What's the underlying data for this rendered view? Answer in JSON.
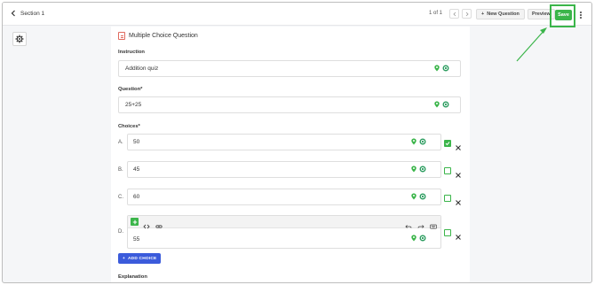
{
  "header": {
    "back_label": "Section 1",
    "page_indicator": "1 of 1",
    "new_question_label": "New Question",
    "preview_label": "Preview",
    "save_label": "Save"
  },
  "question": {
    "type_label": "Multiple Choice Question",
    "instruction_label": "Instruction",
    "instruction_value": "Addition quiz",
    "question_label": "Question*",
    "question_value": "25+25",
    "choices_label": "Choices*",
    "choices": [
      {
        "letter": "A.",
        "value": "50",
        "correct": true
      },
      {
        "letter": "B.",
        "value": "45",
        "correct": false
      },
      {
        "letter": "C.",
        "value": "60",
        "correct": false
      },
      {
        "letter": "D.",
        "value": "55",
        "correct": false
      }
    ],
    "add_choice_label": "ADD CHOICE",
    "explanation_label": "Explanation"
  },
  "icons": {
    "back": "chevron-left-icon",
    "settings": "gear-icon",
    "field_tools": [
      "location-pin-icon",
      "image-record-icon"
    ],
    "editor_tools": [
      "plus-icon",
      "code-icon",
      "link-icon",
      "undo-icon",
      "redo-icon",
      "keyboard-icon"
    ]
  },
  "colors": {
    "accent_green": "#3bb54a",
    "accent_blue": "#3b5bdb",
    "qtype_icon": "#e06a5e"
  }
}
